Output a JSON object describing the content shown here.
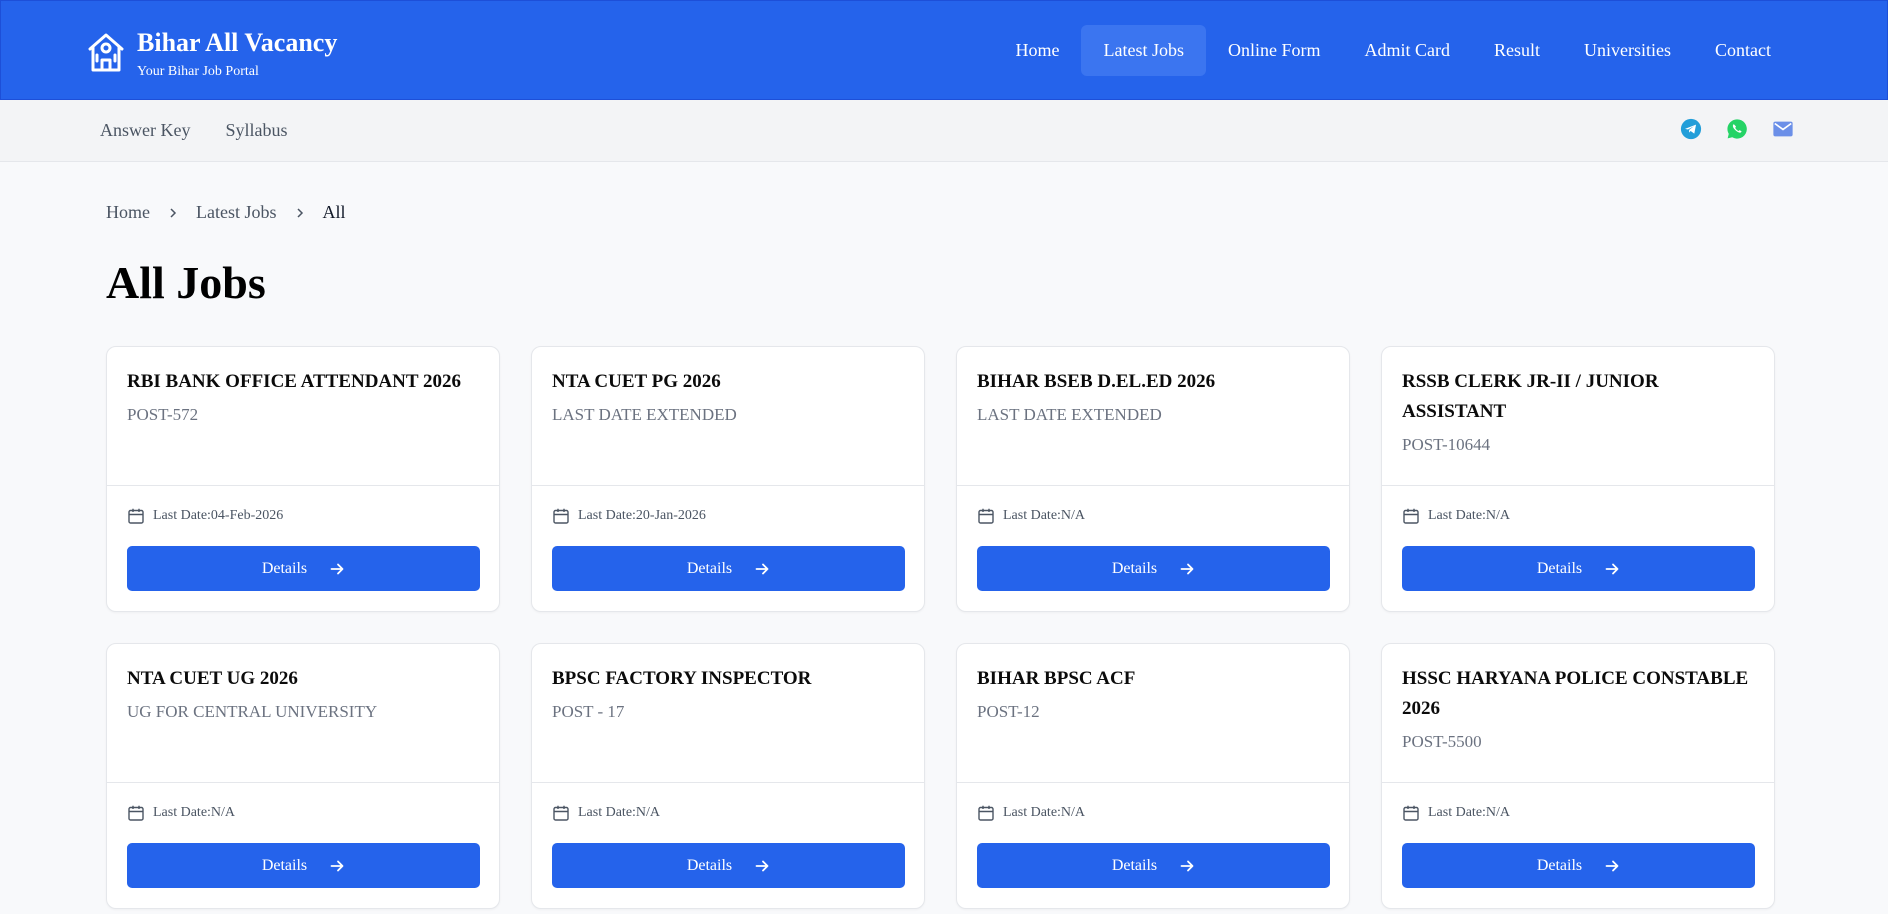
{
  "brand": {
    "title": "Bihar All Vacancy",
    "tagline": "Your Bihar Job Portal",
    "icon": "school-building-icon"
  },
  "nav": [
    {
      "label": "Home",
      "active": false
    },
    {
      "label": "Latest Jobs",
      "active": true
    },
    {
      "label": "Online Form",
      "active": false
    },
    {
      "label": "Admit Card",
      "active": false
    },
    {
      "label": "Result",
      "active": false
    },
    {
      "label": "Universities",
      "active": false
    },
    {
      "label": "Contact",
      "active": false
    }
  ],
  "subnav": [
    {
      "label": "Answer Key"
    },
    {
      "label": "Syllabus"
    }
  ],
  "socials": [
    {
      "name": "telegram-icon",
      "color": "#229ED9"
    },
    {
      "name": "whatsapp-icon",
      "color": "#25D366"
    },
    {
      "name": "mail-icon",
      "color": "#6b8fe8"
    }
  ],
  "breadcrumb": [
    "Home",
    "Latest Jobs",
    "All"
  ],
  "page": {
    "title": "All Jobs"
  },
  "details_label": "Details",
  "date_prefix": "Last Date: ",
  "jobs": [
    {
      "title": "RBI BANK OFFICE ATTENDANT 2026",
      "subtitle": "POST-572",
      "last_date": "04-Feb-2026"
    },
    {
      "title": "NTA CUET PG 2026",
      "subtitle": "LAST DATE EXTENDED",
      "last_date": "20-Jan-2026"
    },
    {
      "title": "BIHAR BSEB D.EL.ED 2026",
      "subtitle": "LAST DATE EXTENDED",
      "last_date": "N/A"
    },
    {
      "title": "RSSB CLERK JR-II / JUNIOR ASSISTANT",
      "subtitle": "POST-10644",
      "last_date": "N/A"
    },
    {
      "title": "NTA CUET UG 2026",
      "subtitle": "UG FOR CENTRAL UNIVERSITY",
      "last_date": "N/A"
    },
    {
      "title": "BPSC FACTORY INSPECTOR",
      "subtitle": "POST - 17",
      "last_date": "N/A"
    },
    {
      "title": "BIHAR BPSC ACF",
      "subtitle": "POST-12",
      "last_date": "N/A"
    },
    {
      "title": "HSSC HARYANA POLICE CONSTABLE 2026",
      "subtitle": "POST-5500",
      "last_date": "N/A"
    }
  ],
  "colors": {
    "primary": "#2563eb",
    "active_nav": "#3b75f0"
  }
}
